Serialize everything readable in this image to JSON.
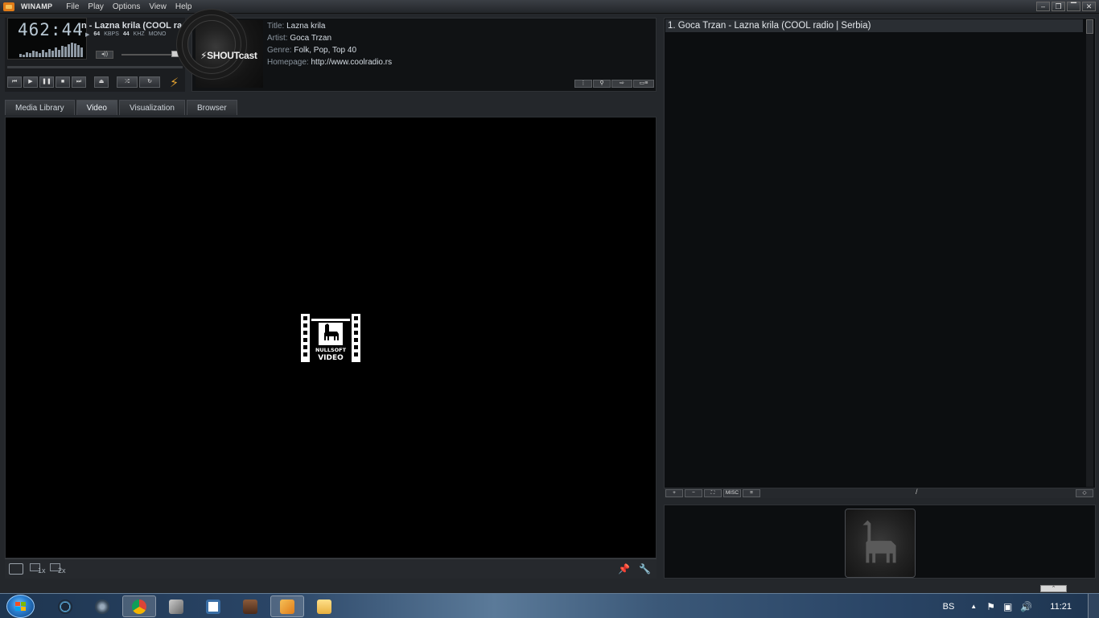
{
  "app": {
    "title": "WINAMP"
  },
  "menu": [
    "File",
    "Play",
    "Options",
    "View",
    "Help"
  ],
  "window_buttons": [
    "minimize",
    "restore",
    "maximize",
    "close"
  ],
  "player": {
    "time": "462:44",
    "ticker": "n - Lazna krila (COOL rad",
    "kbps": "64",
    "kbps_label": "KBPS",
    "khz": "44",
    "khz_label": "KHZ",
    "channel": "MONO",
    "vis_levels": [
      4,
      3,
      6,
      5,
      8,
      7,
      5,
      9,
      6,
      10,
      8,
      12,
      9,
      14,
      13,
      16,
      18,
      17,
      15,
      12
    ],
    "volume_fraction": 0.9
  },
  "now_playing": {
    "art_label": "SHOUTcast",
    "title_label": "Title:",
    "title": "Lazna krila",
    "artist_label": "Artist:",
    "artist": "Goca Trzan",
    "genre_label": "Genre:",
    "genre": "Folk, Pop, Top 40",
    "homepage_label": "Homepage:",
    "homepage": "http://www.coolradio.rs"
  },
  "tabs": [
    "Media Library",
    "Video",
    "Visualization",
    "Browser"
  ],
  "active_tab": "Video",
  "video": {
    "logo_top": "NULLSOFT",
    "logo_bottom": "VIDEO",
    "size_1x": "1x",
    "size_2x": "2x"
  },
  "playlist": {
    "items": [
      "1. Goca Trzan - Lazna krila (COOL radio | Serbia)"
    ],
    "buttons": [
      "+",
      "−",
      "⛶",
      "MISC",
      "≡"
    ],
    "center_text": "/"
  },
  "taskbar": {
    "language": "BS",
    "clock": "11:21",
    "apps": [
      "steam",
      "winamp",
      "chrome",
      "tools",
      "window",
      "media",
      "winamp-active",
      "folder"
    ]
  },
  "colors": {
    "accent": "#e07b18",
    "panel": "#24272b",
    "text": "#d6dde4"
  }
}
